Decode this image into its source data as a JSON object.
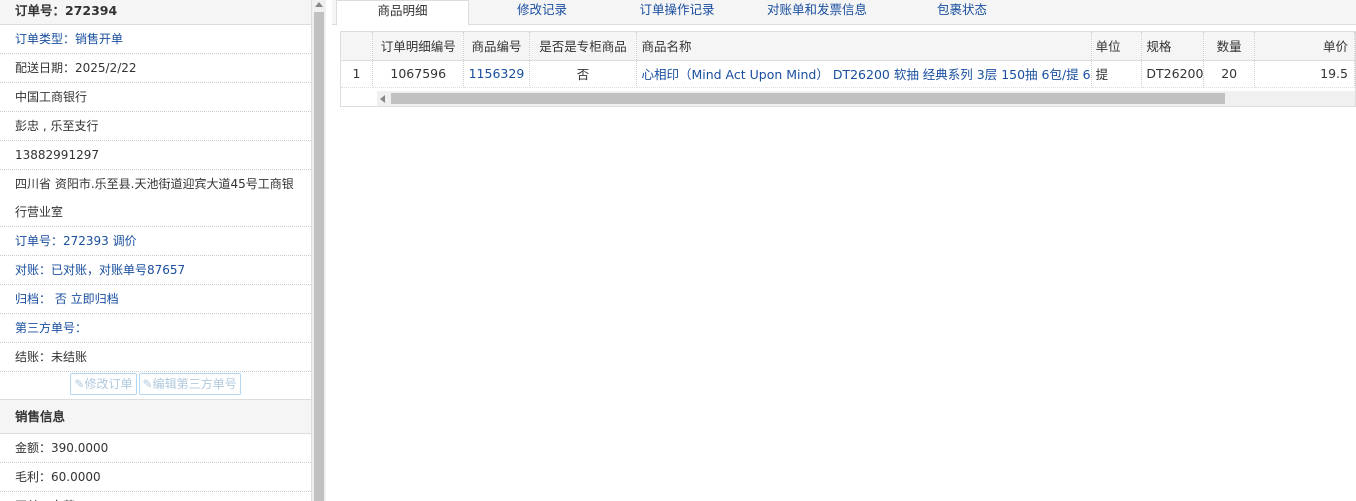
{
  "order": {
    "header": "订单号：272394",
    "rows": [
      "订单类型：销售开单",
      "配送日期：2025/2/22",
      "中国工商银行",
      "彭忠 , 乐至支行",
      "13882991297"
    ],
    "address": "四川省 资阳市.乐至县.天池街道迎宾大道45号工商银行营业室",
    "rows2": [
      "订单号：272393 调价",
      "对账：已对账，对账单号87657",
      "归档： 否 立即归档",
      "第三方单号：",
      "结账：未结账"
    ],
    "buttons": {
      "edit_order": "修改订单",
      "edit_third": "编辑第三方单号"
    }
  },
  "sales": {
    "header": "销售信息",
    "amount": "金额：390.0000",
    "profit": "毛利：60.0000",
    "partial": "开单：白莉"
  },
  "tabs": [
    "商品明细",
    "修改记录",
    "订单操作记录",
    "对账单和发票信息",
    "包裹状态"
  ],
  "table": {
    "headers": [
      "",
      "订单明细编号",
      "商品编号",
      "是否是专柜商品",
      "商品名称",
      "单位",
      "规格",
      "数量",
      "单价"
    ],
    "rows": [
      [
        "1",
        "1067596",
        "1156329",
        "否",
        "心相印（Mind Act Upon Mind） DT26200 软抽 经典系列 3层 150抽 6包/提 6",
        "提",
        "DT26200",
        "20",
        "19.5"
      ]
    ]
  },
  "colors": {
    "link": "#1a4fa0",
    "header_bg": "#f5f5f5",
    "border": "#dddddd"
  }
}
